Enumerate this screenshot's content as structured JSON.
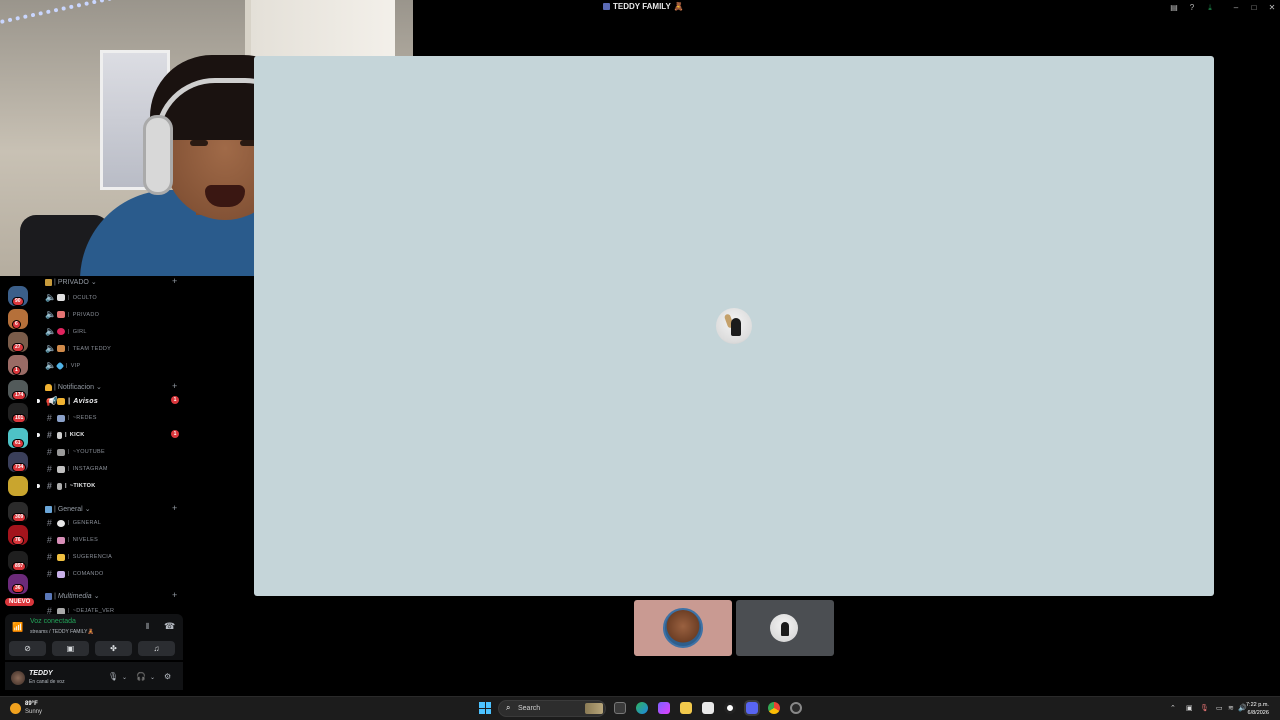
{
  "window": {
    "title": "TEDDY FAMILY",
    "title_emoji": "🧸"
  },
  "titlebar_icons": [
    "inbox-icon",
    "help-icon",
    "download-icon",
    "minimize-icon",
    "maximize-icon",
    "close-icon"
  ],
  "server_rail": {
    "badges": [
      "90",
      "6",
      "27",
      "1",
      "174",
      "101",
      "61",
      "734",
      "309",
      "76",
      "897",
      "36"
    ],
    "new_label": "NUEVO"
  },
  "categories": [
    {
      "name": "PRIVADO",
      "channels": [
        {
          "name": "OCULTO",
          "type": "voice"
        },
        {
          "name": "PRIVADO",
          "type": "voice"
        },
        {
          "name": "GIRL",
          "type": "voice"
        },
        {
          "name": "TEAM TEDDY",
          "type": "voice"
        },
        {
          "name": "VIP",
          "type": "voice"
        }
      ]
    },
    {
      "name": "Notificacion",
      "channels": [
        {
          "name": "Avisos",
          "type": "announcement",
          "unread": true,
          "badge": "1"
        },
        {
          "name": "~REDES",
          "type": "text"
        },
        {
          "name": "KICK",
          "type": "text",
          "unread": true,
          "badge": "1"
        },
        {
          "name": "~YOUTUBE",
          "type": "text"
        },
        {
          "name": "INSTAGRAM",
          "type": "text"
        },
        {
          "name": "~TIKTOK",
          "type": "text",
          "unread": true
        }
      ]
    },
    {
      "name": "General",
      "channels": [
        {
          "name": "GENERAL",
          "type": "text"
        },
        {
          "name": "NIVELES",
          "type": "text"
        },
        {
          "name": "SUGERENCIA",
          "type": "text"
        },
        {
          "name": "COMANDO",
          "type": "text"
        }
      ]
    },
    {
      "name": "Multimedia",
      "channels": [
        {
          "name": "~DEJATE_VER",
          "type": "text"
        }
      ]
    }
  ],
  "voice_panel": {
    "status": "Voz conectada",
    "location": "streams / TEDDY FAMILY🧸"
  },
  "user_panel": {
    "username": "TEDDY",
    "status": "En canal de voz"
  },
  "taskbar": {
    "temperature": "89°F",
    "weather": "Sunny",
    "search_label": "Search",
    "time": "7:22 p.m.",
    "date": "6/8/2026"
  }
}
